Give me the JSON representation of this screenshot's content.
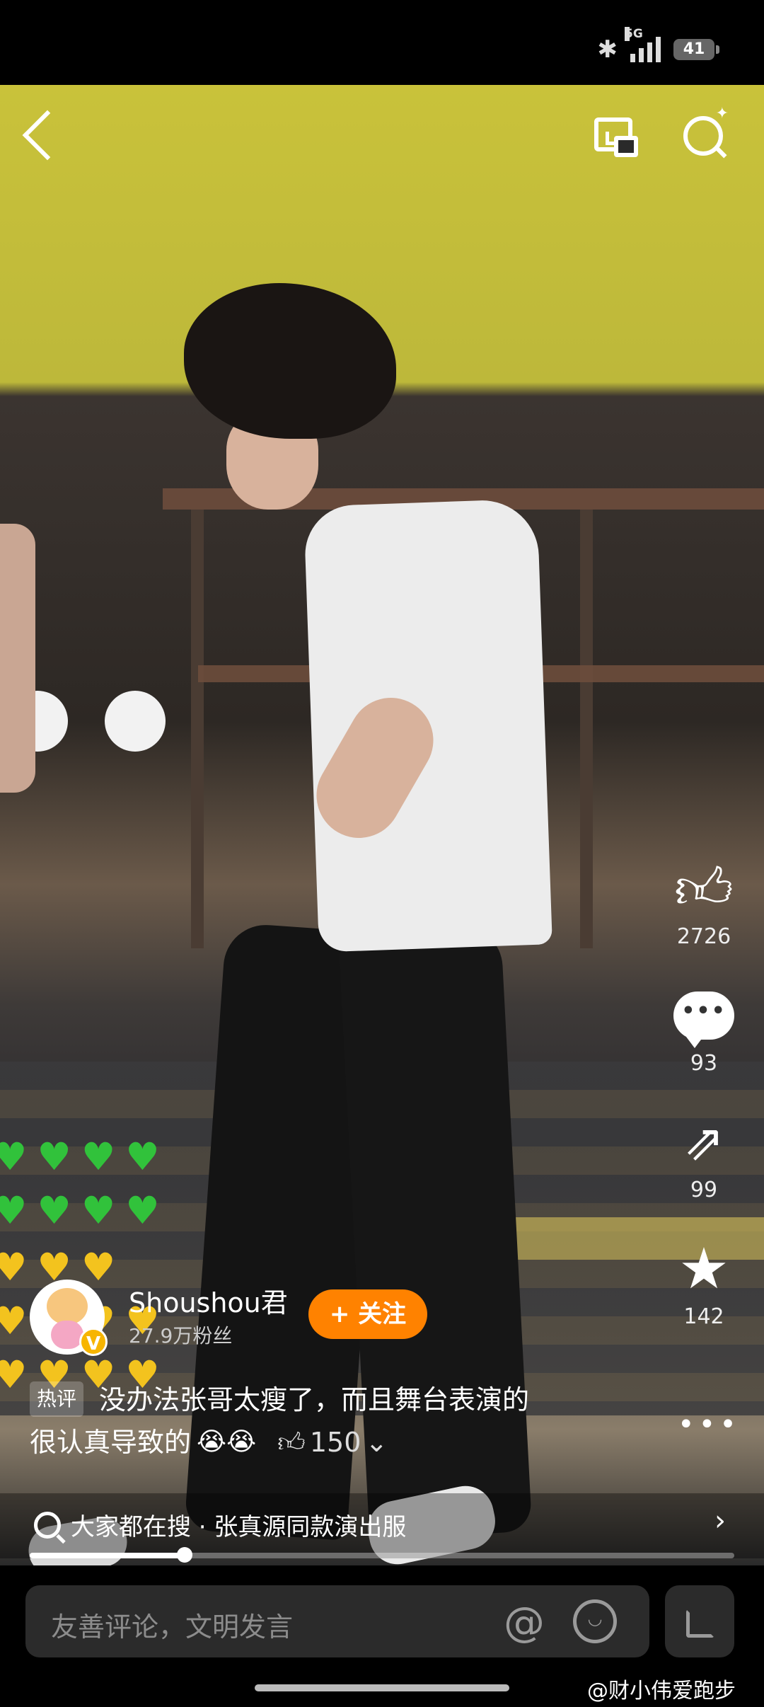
{
  "status": {
    "network": "5G",
    "battery": "41"
  },
  "author": {
    "name": "Shoushou君",
    "fans": "27.9万粉丝",
    "follow_label": "+ 关注"
  },
  "actions": [
    {
      "icon": "thumbs-up-icon",
      "count": "2726"
    },
    {
      "icon": "comment-icon",
      "count": "93"
    },
    {
      "icon": "share-icon",
      "count": "99"
    },
    {
      "icon": "star-icon",
      "count": "142"
    }
  ],
  "hot_comment": {
    "tag": "热评",
    "text_line1": "没办法张哥太瘦了，而且舞台表演的",
    "text_line2": "很认真导致的",
    "emoji": "😭😭",
    "likes": "150"
  },
  "search_suggestion": "大家都在搜 · 张真源同款演出服",
  "progress": 0.22,
  "comment_input": {
    "placeholder": "友善评论，文明发言"
  },
  "watermark": "@财小伟爱跑步",
  "colors": {
    "follow": "#ff8200",
    "verified": "#f7b500",
    "green_heart": "#31c23b",
    "yellow_heart": "#f3c31e"
  }
}
